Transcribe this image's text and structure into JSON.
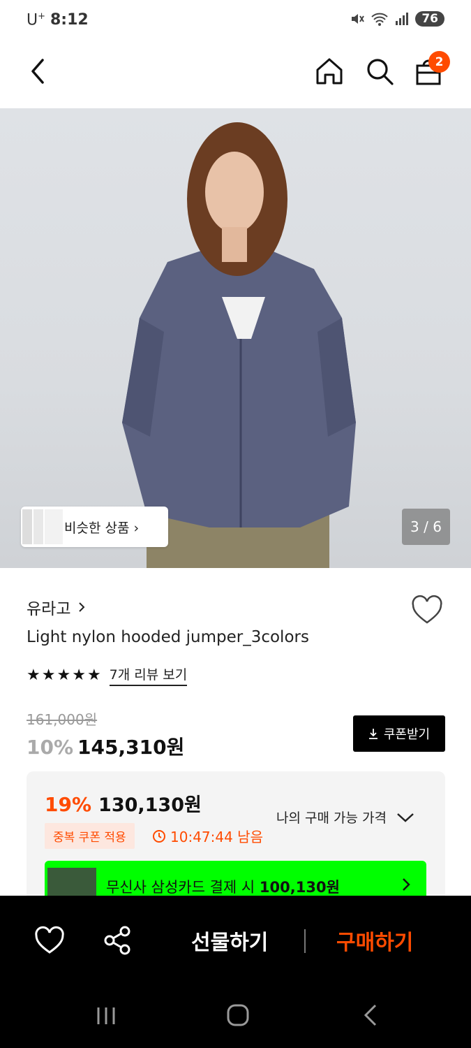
{
  "status_bar": {
    "carrier": "U",
    "carrier_sup": "+",
    "time": "8:12",
    "battery": "76"
  },
  "header": {
    "cart_count": "2"
  },
  "hero": {
    "similar_label": "비슷한 상품 ›",
    "image_counter": "3 / 6"
  },
  "product": {
    "brand": "유라고",
    "title": "Light nylon hooded jumper_3colors",
    "rating_stars": 5,
    "review_link": "7개 리뷰 보기",
    "original_price": "161,000원",
    "discount_percent": "10%",
    "price": "145,310원",
    "coupon_button": "쿠폰받기"
  },
  "purchase_box": {
    "discount_percent": "19%",
    "price": "130,130원",
    "coupon_tag": "중복 쿠폰 적용",
    "timer": "10:47:44 남음",
    "my_price_label": "나의 구매 가능 가격",
    "card_banner_text": "무신사 삼성카드 결제 시",
    "card_banner_price": "100,130원"
  },
  "bottom_bar": {
    "gift_label": "선물하기",
    "buy_label": "구매하기"
  },
  "colors": {
    "accent": "#ff4b00",
    "card_green": "#00ff00",
    "bottom_bar": "#000000"
  },
  "icons": [
    "back-icon",
    "home-icon",
    "search-icon",
    "shopping-bag-icon",
    "heart-icon",
    "share-icon",
    "chevron-down-icon",
    "clock-icon",
    "download-icon"
  ]
}
